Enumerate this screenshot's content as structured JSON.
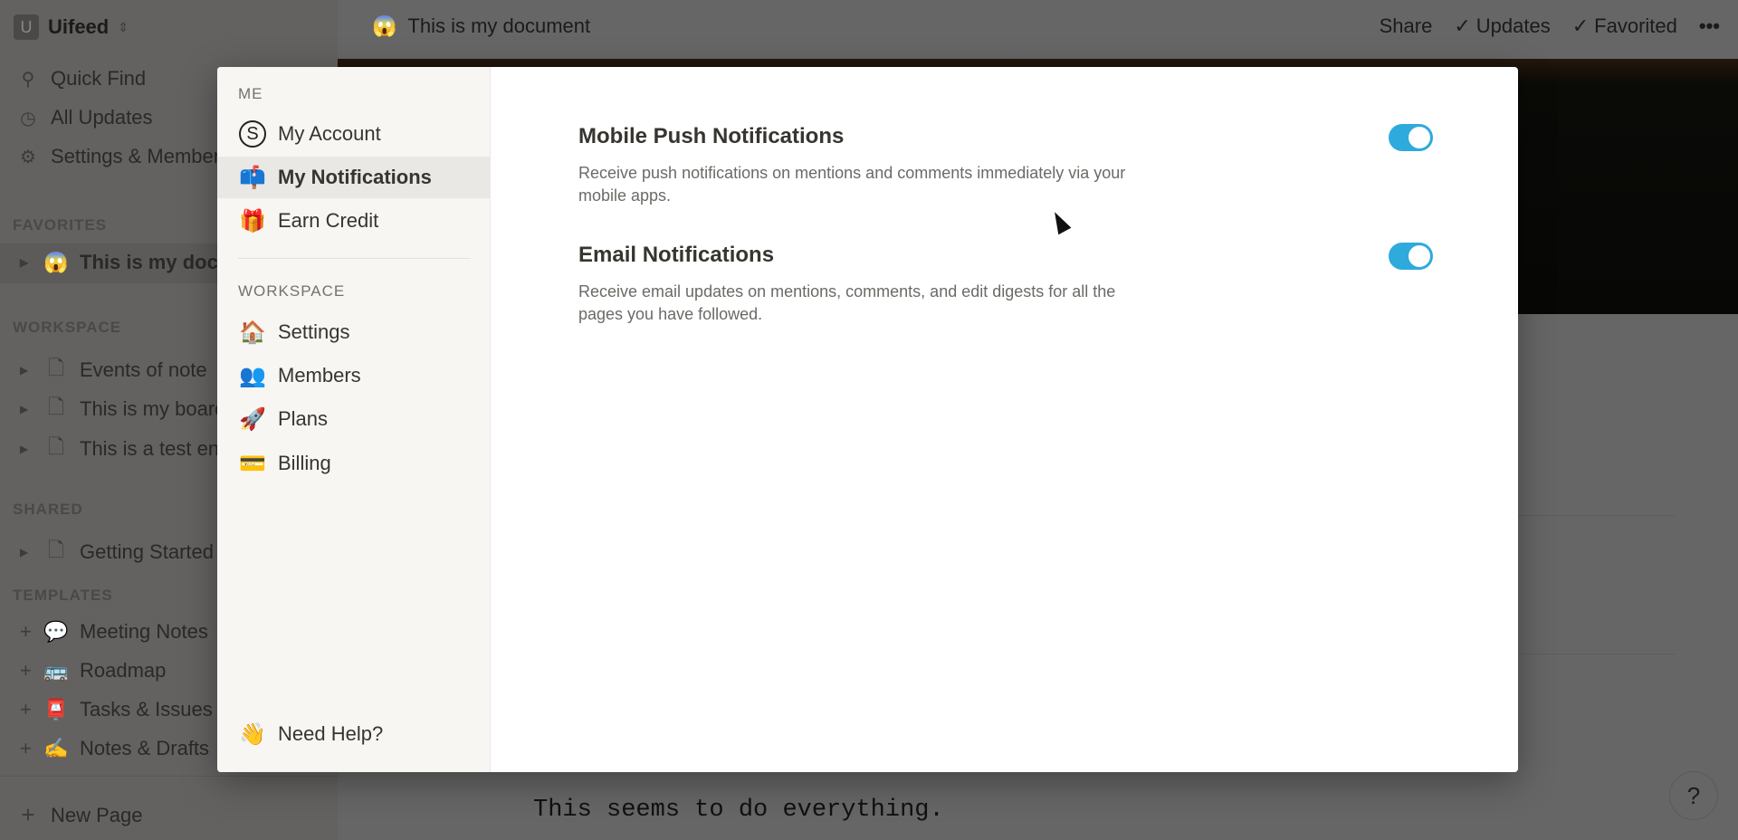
{
  "workspace": {
    "badge": "U",
    "name": "Uifeed"
  },
  "sidebar": {
    "nav": [
      {
        "icon": "search-icon",
        "label": "Quick Find"
      },
      {
        "icon": "clock-icon",
        "label": "All Updates"
      },
      {
        "icon": "gear-icon",
        "label": "Settings & Members"
      }
    ],
    "favorites_label": "FAVORITES",
    "favorites": [
      {
        "icon": "😱",
        "label": "This is my document"
      }
    ],
    "workspace_label": "WORKSPACE",
    "workspace_pages": [
      {
        "label": "Events of note"
      },
      {
        "label": "This is my board"
      },
      {
        "label": "This is a test entry"
      }
    ],
    "shared_label": "SHARED",
    "shared_pages": [
      {
        "label": "Getting Started"
      }
    ],
    "templates_label": "TEMPLATES",
    "templates": [
      {
        "icon": "💬",
        "label": "Meeting Notes"
      },
      {
        "icon": "🚌",
        "label": "Roadmap"
      },
      {
        "icon": "📮",
        "label": "Tasks & Issues"
      },
      {
        "icon": "✍",
        "label": "Notes & Drafts"
      }
    ],
    "new_page": "New Page"
  },
  "topbar": {
    "doc_icon": "😱",
    "title": "This is my document",
    "share": "Share",
    "updates": "Updates",
    "favorited": "Favorited",
    "more": "•••"
  },
  "document": {
    "text_line": "This seems to do everything."
  },
  "help_button": "?",
  "modal": {
    "me_label": "ME",
    "me_items": [
      {
        "icon": "S",
        "label": "My Account"
      },
      {
        "icon": "📫",
        "label": "My Notifications",
        "active": true
      },
      {
        "icon": "🎁",
        "label": "Earn Credit"
      }
    ],
    "workspace_label": "WORKSPACE",
    "workspace_items": [
      {
        "icon": "🏠",
        "label": "Settings"
      },
      {
        "icon": "👥",
        "label": "Members"
      },
      {
        "icon": "🚀",
        "label": "Plans"
      },
      {
        "icon": "💳",
        "label": "Billing"
      }
    ],
    "help": {
      "icon": "👋",
      "label": "Need Help?"
    },
    "settings": [
      {
        "title": "Mobile Push Notifications",
        "description": "Receive push notifications on mentions and comments immediately via your mobile apps.",
        "enabled": true
      },
      {
        "title": "Email Notifications",
        "description": "Receive email updates on mentions, comments, and edit digests for all the pages you have followed.",
        "enabled": true
      }
    ],
    "toggle_color": "#2eaadc"
  }
}
